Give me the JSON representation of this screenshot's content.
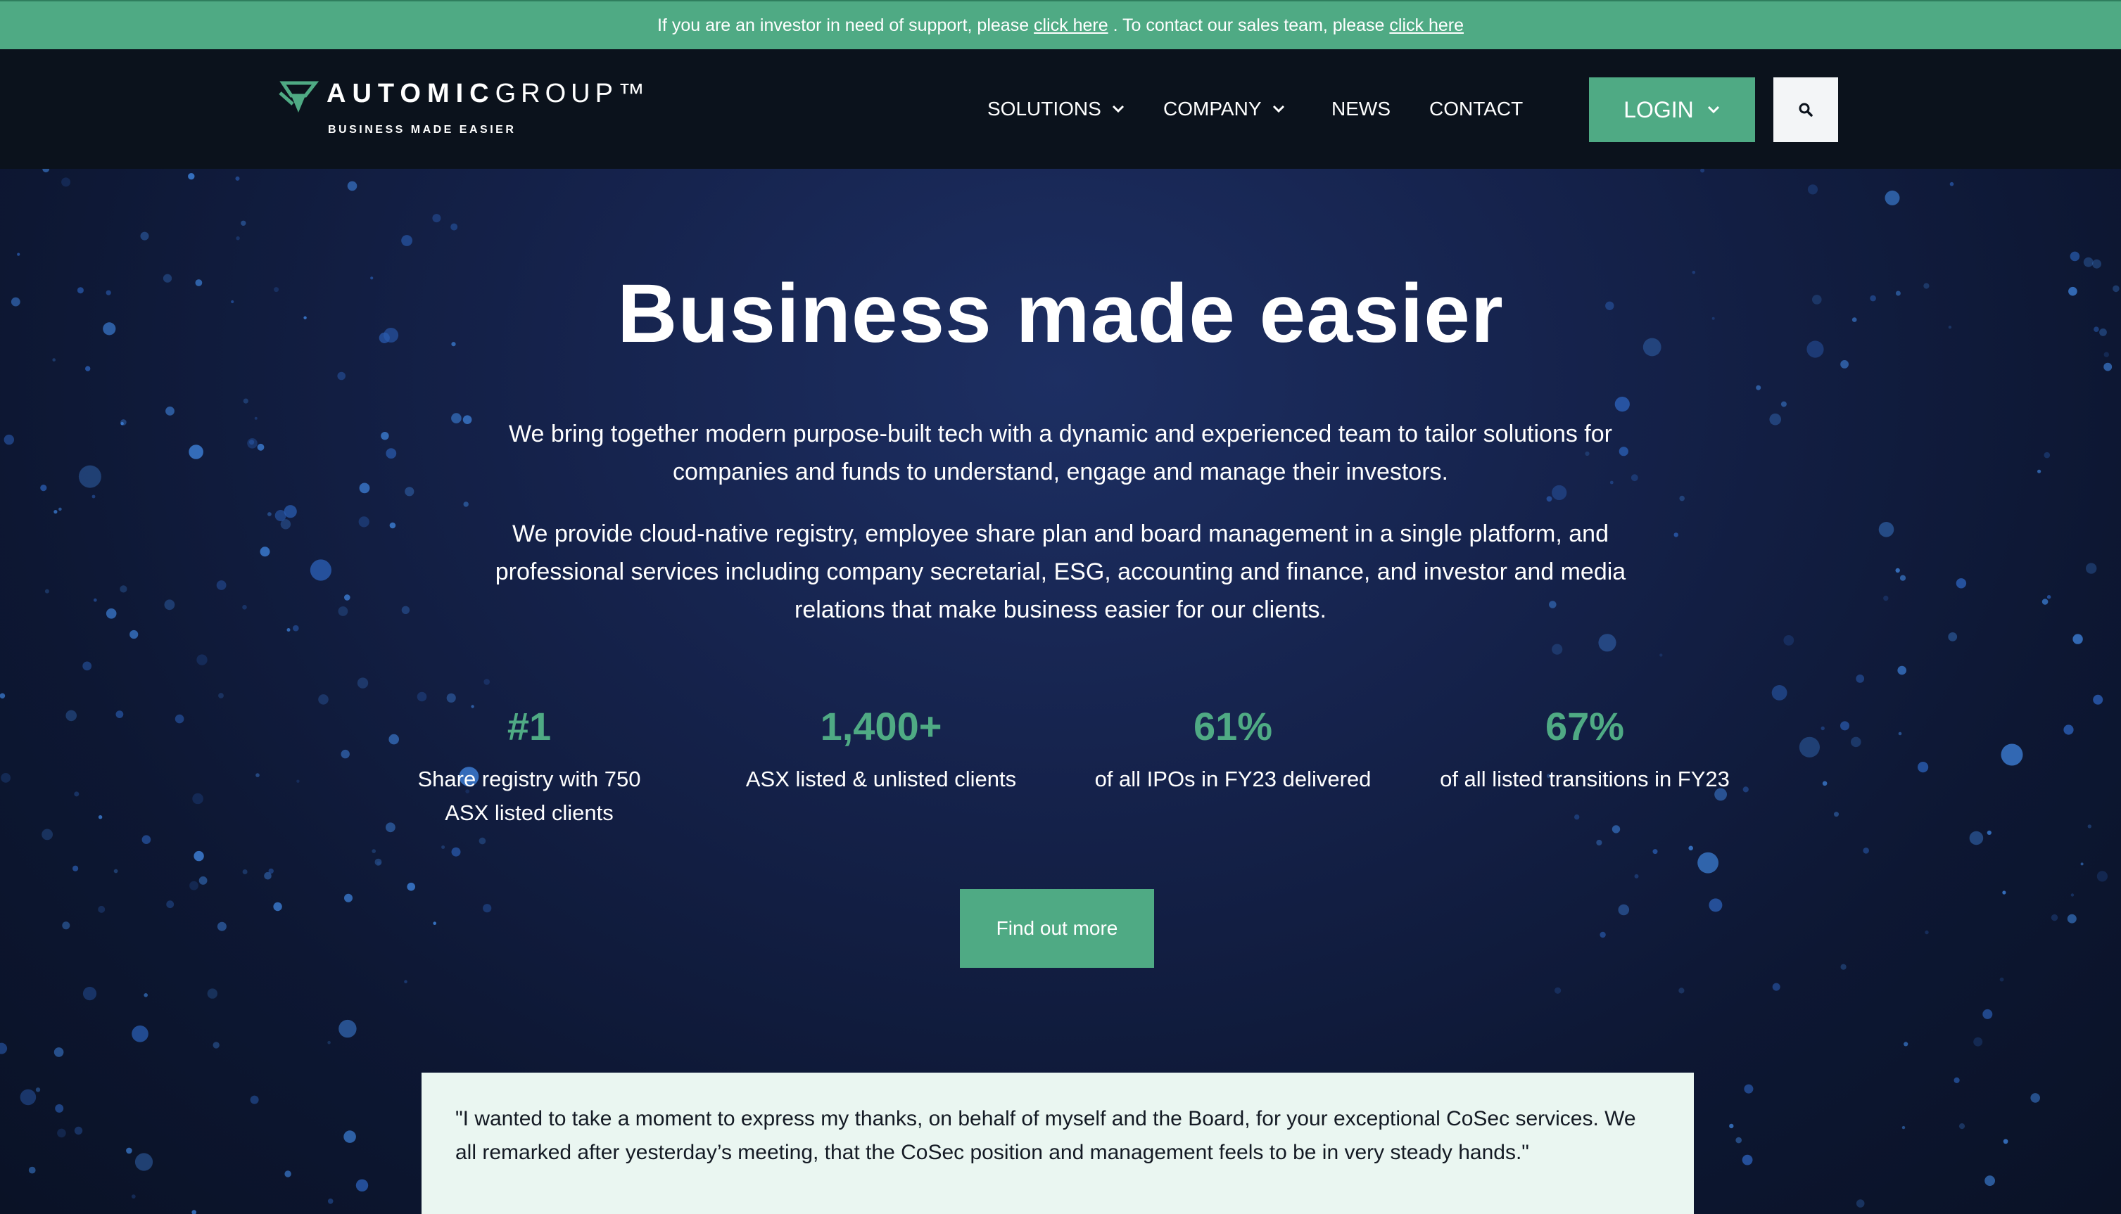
{
  "announcement": {
    "text_1": "If you are an investor in need of support, please ",
    "link_1": "click here",
    "text_2": " . To contact our sales team, please ",
    "link_2": "click here"
  },
  "header": {
    "logo": {
      "word_bold": "AUTOMIC",
      "word_light": "GROUP™",
      "tagline": "BUSINESS MADE EASIER"
    },
    "nav": [
      {
        "label": "SOLUTIONS",
        "has_dropdown": true
      },
      {
        "label": "COMPANY",
        "has_dropdown": true
      },
      {
        "label": "NEWS",
        "has_dropdown": false
      },
      {
        "label": "CONTACT",
        "has_dropdown": false
      }
    ],
    "login_label": "LOGIN",
    "search_icon": "search-icon"
  },
  "hero": {
    "title": "Business made easier",
    "paragraph_1": "We bring together modern purpose-built tech with a dynamic and experienced team to tailor solutions for companies and funds to understand, engage and manage their investors.",
    "paragraph_2": "We provide cloud-native registry, employee share plan and board management in a single platform, and professional services including company secretarial, ESG, accounting and finance, and investor and media relations that make business easier for our clients.",
    "stats": [
      {
        "value": "#1",
        "label": "Share registry with 750 ASX listed clients"
      },
      {
        "value": "1,400+",
        "label": "ASX listed & unlisted clients"
      },
      {
        "value": "61%",
        "label": "of all IPOs in FY23 delivered"
      },
      {
        "value": "67%",
        "label": "of all listed transitions in FY23"
      }
    ],
    "cta_label": "Find out more"
  },
  "testimonial": {
    "quote": "\"I wanted to take a moment to express my thanks, on behalf of myself and the Board, for your exceptional CoSec services. We all remarked after yesterday’s meeting, that the CoSec position and management feels to be in very steady hands.\""
  },
  "colors": {
    "accent": "#4faa84",
    "header_bg": "#0b121c",
    "hero_bg": "#15224b",
    "quote_bg": "#eaf6f1"
  }
}
